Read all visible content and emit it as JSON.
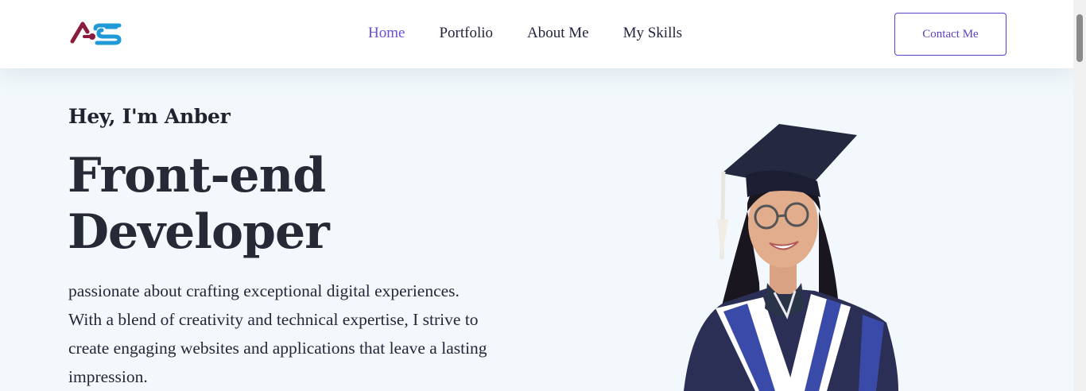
{
  "brand": {
    "logo_text": "AS",
    "logo_icon": "as-logo-icon"
  },
  "nav": {
    "items": [
      {
        "label": "Home",
        "active": true
      },
      {
        "label": "Portfolio",
        "active": false
      },
      {
        "label": "About Me",
        "active": false
      },
      {
        "label": "My Skills",
        "active": false
      }
    ],
    "contact_label": "Contact Me"
  },
  "hero": {
    "greeting": "Hey, I'm Anber",
    "role_line1": "Front-end",
    "role_line2": "Developer",
    "bio_line1": "passionate about crafting exceptional digital experiences.",
    "bio_line2": "With a blend of creativity and technical expertise, I strive to",
    "bio_line3": "create engaging websites and applications that leave a lasting",
    "bio_line4": "impression.",
    "photo_icon": "graduate-portrait-image"
  },
  "colors": {
    "accent": "#6a4fd6",
    "text_dark": "#262a36",
    "hero_bg": "#f2f8fb",
    "logo_red": "#8b1c3c",
    "logo_blue": "#1f9ad6"
  }
}
